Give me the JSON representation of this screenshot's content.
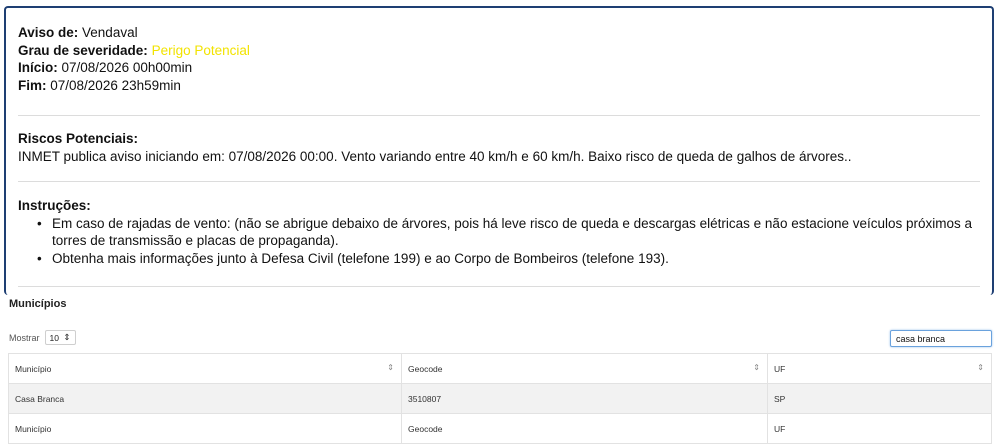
{
  "alert": {
    "event_label": "Aviso de:",
    "event_value": "Vendaval",
    "severity_label": "Grau de severidade:",
    "severity_value": "Perigo Potencial",
    "severity_color": "#f2e300",
    "start_label": "Início:",
    "start_value": "07/08/2026 00h00min",
    "end_label": "Fim:",
    "end_value": "07/08/2026 23h59min",
    "risks_title": "Riscos Potenciais:",
    "risks_text": "INMET publica aviso iniciando em: 07/08/2026 00:00. Vento variando entre 40 km/h e 60 km/h. Baixo risco de queda de galhos de árvores..",
    "instructions_title": "Instruções:",
    "instructions": [
      "Em caso de rajadas de vento: (não se abrigue debaixo de árvores, pois há leve risco de queda e descargas elétricas e não estacione veículos próximos a torres de transmissão e placas de propaganda).",
      "Obtenha mais informações junto à Defesa Civil (telefone 199) e ao Corpo de Bombeiros (telefone 193)."
    ],
    "border_color": "#1e3f73"
  },
  "municipios": {
    "title": "Municípios",
    "length_label": "Mostrar",
    "length_value": "10",
    "search_value": "casa branca",
    "columns": [
      "Município",
      "Geocode",
      "UF"
    ],
    "rows": [
      [
        "Casa Branca",
        "3510807",
        "SP"
      ]
    ],
    "footer": [
      "Município",
      "Geocode",
      "UF"
    ]
  }
}
